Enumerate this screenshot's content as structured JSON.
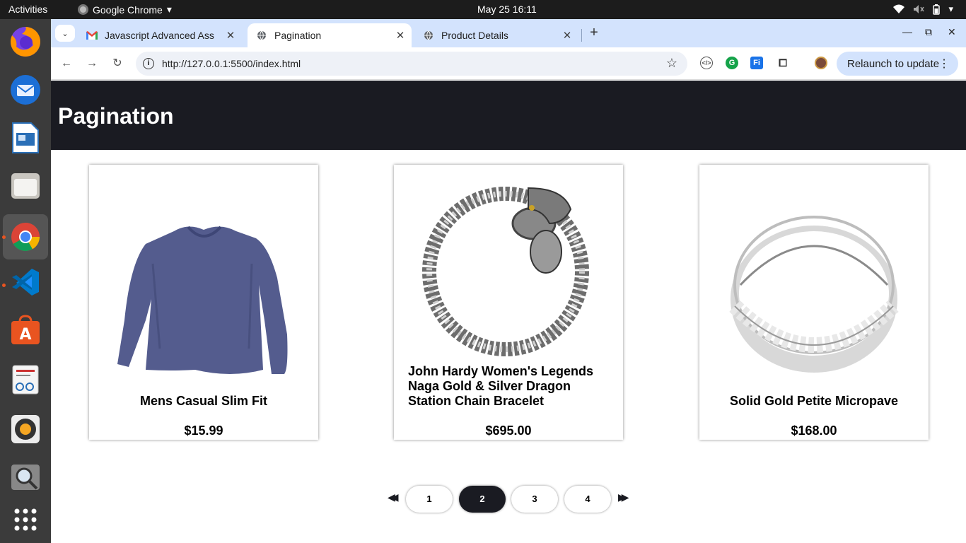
{
  "system": {
    "activities": "Activities",
    "app_name": "Google Chrome",
    "clock": "May 25  16:11"
  },
  "browser": {
    "tabs": [
      {
        "title": "Javascript Advanced Ass",
        "favicon": "gmail-icon"
      },
      {
        "title": "Pagination",
        "favicon": "globe-icon",
        "active": true
      },
      {
        "title": "Product Details",
        "favicon": "globe-icon"
      }
    ],
    "url": "http://127.0.0.1:5500/index.html",
    "relaunch_label": "Relaunch to update"
  },
  "page": {
    "heading": "Pagination",
    "products": [
      {
        "name": "Mens Casual Slim Fit",
        "price": "$15.99",
        "image": "tshirt"
      },
      {
        "name": "John Hardy Women's Legends Naga Gold & Silver Dragon Station Chain Bracelet",
        "price": "$695.00",
        "image": "bracelet"
      },
      {
        "name": "Solid Gold Petite Micropave",
        "price": "$168.00",
        "image": "ring"
      }
    ],
    "pagination": {
      "pages": [
        "1",
        "2",
        "3",
        "4"
      ],
      "current": "2"
    }
  },
  "colors": {
    "header_bg": "#1a1b22",
    "tabstrip_bg": "#d3e3fd",
    "dock_bg": "#3b3b3b"
  }
}
